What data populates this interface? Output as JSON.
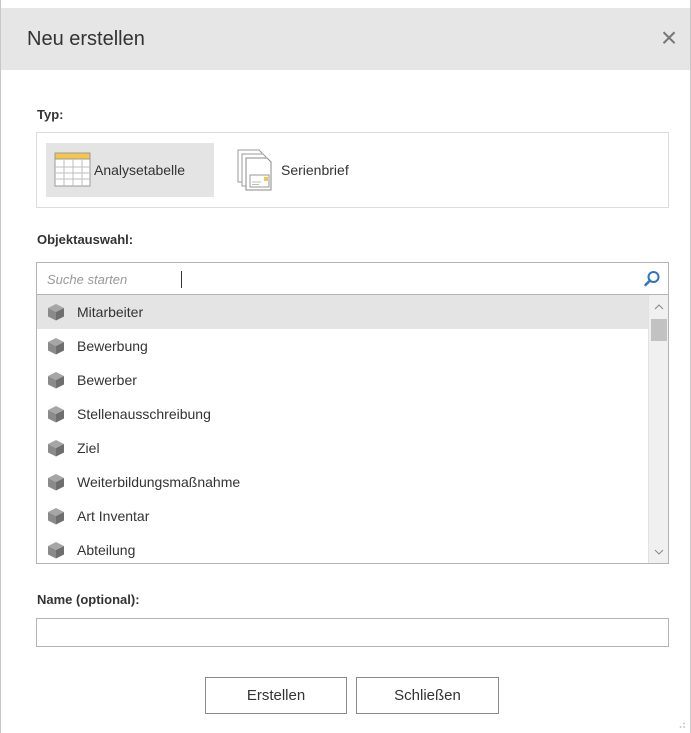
{
  "dialog": {
    "title": "Neu erstellen",
    "close_glyph": "×"
  },
  "typ": {
    "label": "Typ:",
    "options": [
      {
        "label": "Analysetabelle",
        "icon": "table-icon",
        "selected": true
      },
      {
        "label": "Serienbrief",
        "icon": "document-stack-icon",
        "selected": false
      }
    ]
  },
  "objektauswahl": {
    "label": "Objektauswahl:",
    "search_placeholder": "Suche starten",
    "search_value": "",
    "search_icon": "search-icon",
    "items": [
      {
        "label": "Mitarbeiter",
        "selected": true
      },
      {
        "label": "Bewerbung",
        "selected": false
      },
      {
        "label": "Bewerber",
        "selected": false
      },
      {
        "label": "Stellenausschreibung",
        "selected": false
      },
      {
        "label": "Ziel",
        "selected": false
      },
      {
        "label": "Weiterbildungsmaßnahme",
        "selected": false
      },
      {
        "label": "Art Inventar",
        "selected": false
      },
      {
        "label": "Abteilung",
        "selected": false
      }
    ]
  },
  "name": {
    "label": "Name (optional):",
    "value": ""
  },
  "buttons": {
    "create": "Erstellen",
    "close": "Schließen"
  },
  "colors": {
    "titlebar": "#e6e6e6",
    "selected": "#e4e4e4",
    "search_icon": "#2b72c8",
    "table_icon_accent": "#f5c64d",
    "cube_icon": "#8a8a8a"
  }
}
